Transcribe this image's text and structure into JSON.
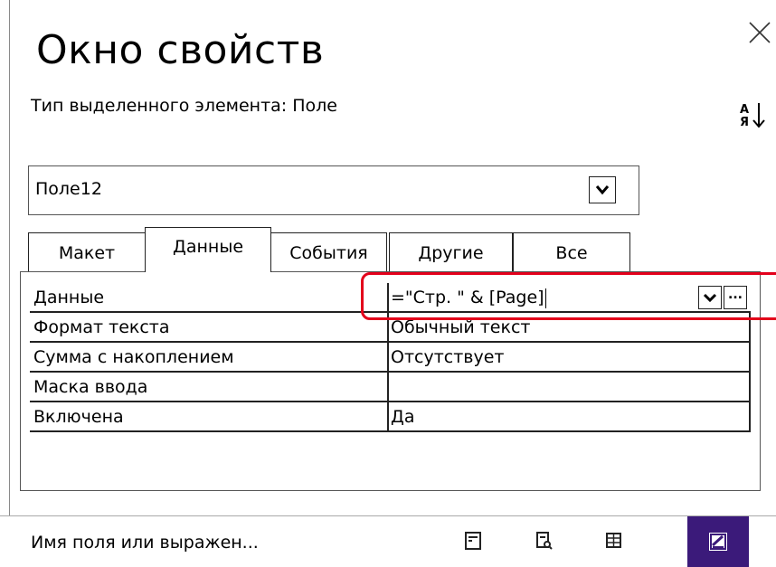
{
  "title": "Окно свойств",
  "selection_type": "Тип выделенного элемента:  Поле",
  "object_selector": {
    "value": "Поле12"
  },
  "tabs": [
    {
      "label": "Макет"
    },
    {
      "label": "Данные"
    },
    {
      "label": "События"
    },
    {
      "label": "Другие"
    },
    {
      "label": "Все"
    }
  ],
  "properties": [
    {
      "label": "Данные",
      "value": "=\"Стр. \" & [Page]"
    },
    {
      "label": "Формат текста",
      "value": "Обычный текст"
    },
    {
      "label": "Сумма с накоплением",
      "value": "Отсутствует"
    },
    {
      "label": "Маска ввода",
      "value": ""
    },
    {
      "label": "Включена",
      "value": "Да"
    }
  ],
  "build_button_label": "...",
  "status": {
    "text": "Имя поля или выражен..."
  },
  "icons": {
    "close": "close-icon",
    "sort": "sort-az-icon",
    "dropdown": "chevron-down-icon",
    "views": [
      "form-view-icon",
      "print-preview-icon",
      "layout-view-icon",
      "design-view-icon"
    ]
  },
  "colors": {
    "highlight": "#e3001b",
    "active_view": "#3b1a7a"
  },
  "active_tab_index": 1,
  "active_view": "design-view-icon"
}
